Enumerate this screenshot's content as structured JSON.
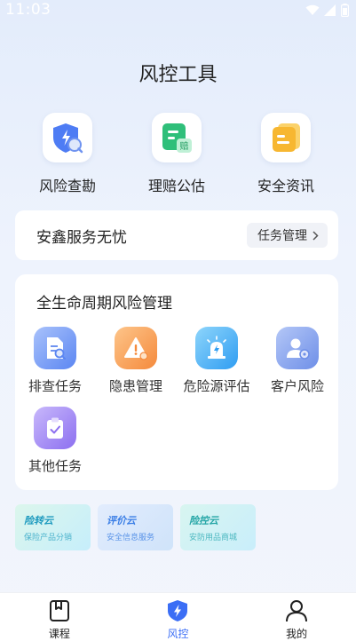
{
  "status": {
    "time": "11:03"
  },
  "page": {
    "title": "风控工具"
  },
  "tools": [
    {
      "label": "风险查勘",
      "icon": "risk-survey-icon"
    },
    {
      "label": "理赔公估",
      "icon": "claims-assessment-icon"
    },
    {
      "label": "安全资讯",
      "icon": "safety-news-icon"
    }
  ],
  "service": {
    "title": "安鑫服务无忧",
    "task_button": "任务管理"
  },
  "lifecycle": {
    "title": "全生命周期风险管理",
    "items": [
      {
        "label": "排查任务",
        "icon": "inspection-task-icon"
      },
      {
        "label": "隐患管理",
        "icon": "hazard-management-icon"
      },
      {
        "label": "危险源评估",
        "icon": "hazard-source-assessment-icon"
      },
      {
        "label": "客户风险",
        "icon": "customer-risk-icon"
      },
      {
        "label": "其他任务",
        "icon": "other-tasks-icon"
      }
    ]
  },
  "banners": [
    {
      "title": "险转云",
      "subtitle": "保险产品分销"
    },
    {
      "title": "评价云",
      "subtitle": "安全信息服务"
    },
    {
      "title": "险控云",
      "subtitle": "安防用品商城"
    }
  ],
  "nav": [
    {
      "label": "课程",
      "icon": "book-icon"
    },
    {
      "label": "风控",
      "icon": "shield-bolt-icon"
    },
    {
      "label": "我的",
      "icon": "user-icon"
    }
  ],
  "colors": {
    "accent": "#3b6ef5",
    "background": "#e8eefb",
    "tool_risk": "#4e7cf4",
    "tool_claims": "#2fbf7a",
    "tool_news": "#f7b731"
  }
}
